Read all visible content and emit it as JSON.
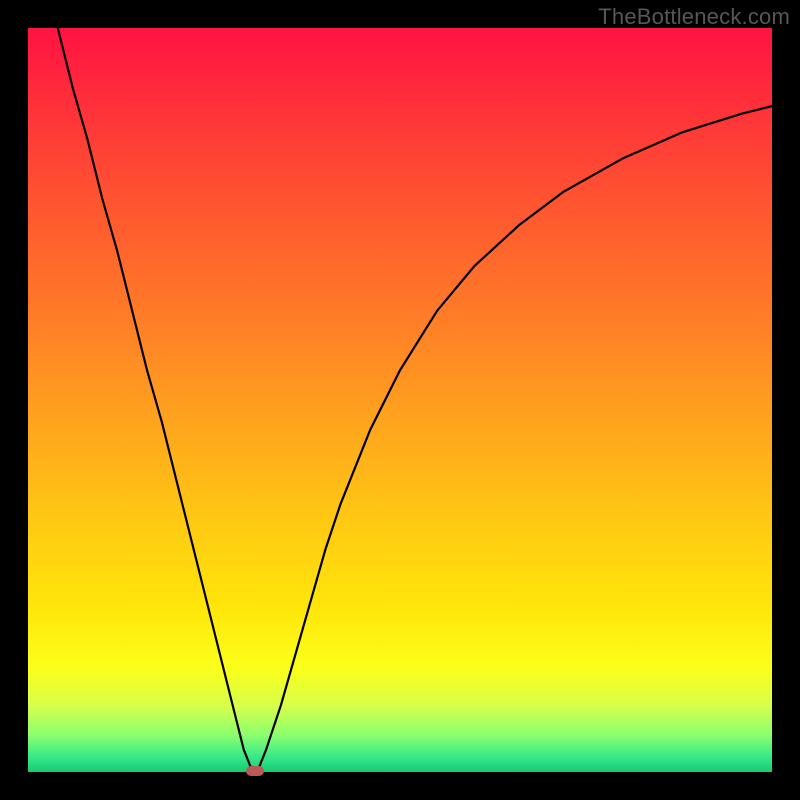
{
  "watermark": "TheBottleneck.com",
  "chart_data": {
    "type": "line",
    "title": "",
    "xlabel": "",
    "ylabel": "",
    "xlim": [
      0,
      100
    ],
    "ylim": [
      0,
      100
    ],
    "series": [
      {
        "name": "curve",
        "x": [
          4,
          6,
          8,
          10,
          12,
          14,
          16,
          18,
          20,
          22,
          24,
          26,
          28,
          29,
          30,
          30.5,
          31,
          32,
          34,
          36,
          38,
          40,
          42,
          46,
          50,
          55,
          60,
          66,
          72,
          80,
          88,
          96,
          100
        ],
        "values": [
          100,
          92,
          85,
          77,
          70,
          62,
          54,
          47,
          39,
          31,
          23,
          15,
          7,
          3,
          0.5,
          0,
          0.5,
          3,
          9,
          16,
          23,
          30,
          36,
          46,
          54,
          62,
          68,
          73.5,
          78,
          82.5,
          86,
          88.5,
          89.5
        ]
      }
    ],
    "marker": {
      "x": 30.5,
      "y": 0
    },
    "colors": {
      "curve": "#000000",
      "marker": "#b95a54",
      "gradient_top": "#ff1342",
      "gradient_bottom": "#18c971"
    }
  }
}
